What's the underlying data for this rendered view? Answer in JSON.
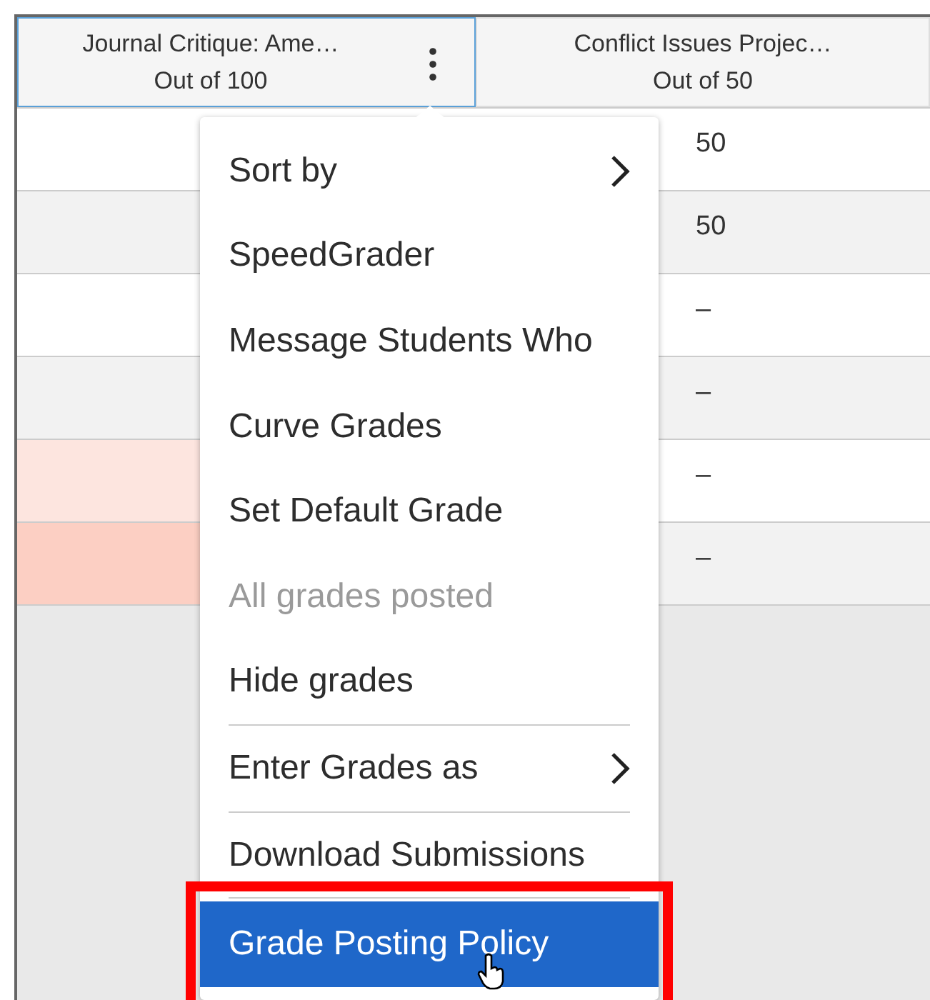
{
  "columns": [
    {
      "title": "Journal Critique: Ame…",
      "points": "Out of 100",
      "active": true,
      "options_icon": true
    },
    {
      "title": "Conflict Issues Projec…",
      "points": "Out of 50",
      "active": false,
      "options_icon": false
    }
  ],
  "rows": [
    {
      "color": "#ffffff",
      "score": "50"
    },
    {
      "color": "#f2f2f2",
      "score": "50"
    },
    {
      "color": "#ffffff",
      "score": "–"
    },
    {
      "color": "#f2f2f2",
      "score": "–"
    },
    {
      "color": "#fde5df",
      "score": "–"
    },
    {
      "color": "#fccfc3",
      "score": "–"
    }
  ],
  "menu": [
    {
      "label": "Sort by",
      "submenu": true,
      "disabled": false,
      "selected": false,
      "divider_before": false
    },
    {
      "label": "SpeedGrader",
      "submenu": false,
      "disabled": false,
      "selected": false,
      "divider_before": false
    },
    {
      "label": "Message Students Who",
      "submenu": false,
      "disabled": false,
      "selected": false,
      "divider_before": false
    },
    {
      "label": "Curve Grades",
      "submenu": false,
      "disabled": false,
      "selected": false,
      "divider_before": false
    },
    {
      "label": "Set Default Grade",
      "submenu": false,
      "disabled": false,
      "selected": false,
      "divider_before": false
    },
    {
      "label": "All grades posted",
      "submenu": false,
      "disabled": true,
      "selected": false,
      "divider_before": false
    },
    {
      "label": "Hide grades",
      "submenu": false,
      "disabled": false,
      "selected": false,
      "divider_before": false
    },
    {
      "label": "Enter Grades as",
      "submenu": true,
      "disabled": false,
      "selected": false,
      "divider_before": true
    },
    {
      "label": "Download Submissions",
      "submenu": false,
      "disabled": false,
      "selected": false,
      "divider_before": true
    },
    {
      "label": "Grade Posting Policy",
      "submenu": false,
      "disabled": false,
      "selected": true,
      "divider_before": true
    }
  ]
}
